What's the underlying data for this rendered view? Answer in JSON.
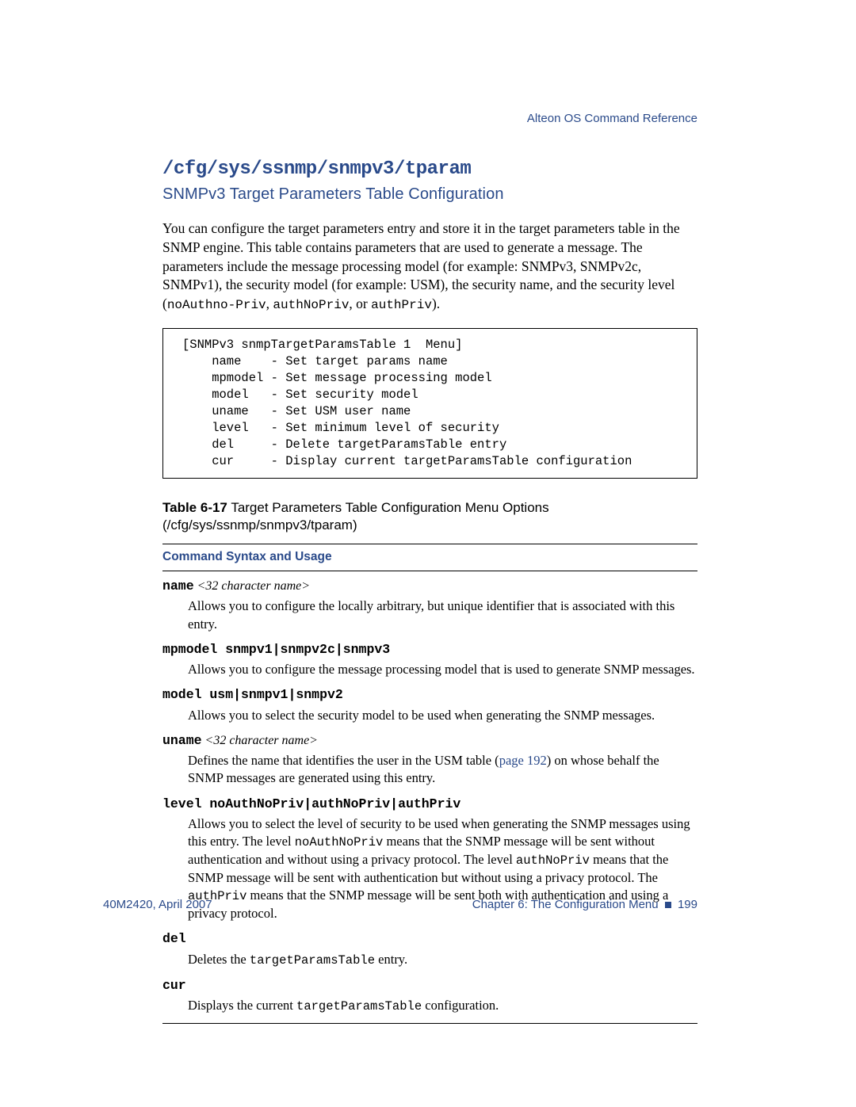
{
  "running_head": "Alteon OS  Command Reference",
  "h1": "/cfg/sys/ssnmp/snmpv3/tparam",
  "h2": "SNMPv3 Target Parameters Table Configuration",
  "intro_text_1": "You can configure the target parameters entry and store it in the target parameters table in the SNMP engine. This table contains parameters that are used to generate a message. The parameters include the message processing model (for example: SNMPv3, SNMPv2c, SNMPv1), the security model (for example: USM), the security name, and the security level (",
  "intro_code_1": "noAuthno-Priv",
  "intro_sep_1": ", ",
  "intro_code_2": "authNoPriv",
  "intro_sep_2": ", or ",
  "intro_code_3": "authPriv",
  "intro_tail": ").",
  "menu_header": "[SNMPv3 snmpTargetParamsTable 1  Menu]",
  "menu_items": [
    {
      "cmd": "name",
      "desc": "Set target params name"
    },
    {
      "cmd": "mpmodel",
      "desc": "Set message processing model"
    },
    {
      "cmd": "model",
      "desc": "Set security model"
    },
    {
      "cmd": "uname",
      "desc": "Set USM user name"
    },
    {
      "cmd": "level",
      "desc": "Set minimum level of security"
    },
    {
      "cmd": "del",
      "desc": "Delete targetParamsTable entry"
    },
    {
      "cmd": "cur",
      "desc": "Display current targetParamsTable configuration"
    }
  ],
  "table_caption_label": "Table 6-17",
  "table_caption_text": "Target Parameters Table Configuration Menu Options (/cfg/sys/ssnmp/snmpv3/tparam)",
  "colhead": "Command Syntax and Usage",
  "entries": {
    "name": {
      "syntax_cmd": "name",
      "syntax_arg": "<32 character name>",
      "desc": "Allows you to configure the locally arbitrary, but unique identifier that is associated with this entry."
    },
    "mpmodel": {
      "syntax_cmd": "mpmodel snmpv1",
      "syntax_alt1": "snmpv2c",
      "syntax_alt2": "snmpv3",
      "desc": "Allows you to configure the message processing model that is used to generate SNMP messages."
    },
    "model": {
      "syntax_cmd": "model usm",
      "syntax_alt1": "snmpv1",
      "syntax_alt2": "snmpv2",
      "desc": "Allows you to select the security model to be used when generating the SNMP messages."
    },
    "uname": {
      "syntax_cmd": "uname",
      "syntax_arg": "<32 character name>",
      "desc_pre": "Defines the name that identifies the user in the USM table (",
      "link": "page 192",
      "desc_post": ") on whose behalf the SNMP messages are generated using this entry."
    },
    "level": {
      "syntax_cmd": "level noAuthNoPriv",
      "syntax_alt1": "authNoPriv",
      "syntax_alt2": "authPriv",
      "desc_p1": "Allows you to select the level of security to be used when generating the SNMP messages using this entry. The level ",
      "code1": "noAuthNoPriv",
      "desc_p2": " means that the SNMP message will be sent without authentication and without using a privacy protocol. The level ",
      "code2": "authNoPriv",
      "desc_p3": " means that the SNMP message will be sent with authentication but without using a privacy protocol. The ",
      "code3": "authPriv",
      "desc_p4": " means that the SNMP message will be sent both with authentication and using a privacy protocol."
    },
    "del": {
      "syntax_cmd": "del",
      "desc_pre": "Deletes the ",
      "code": "targetParamsTable",
      "desc_post": " entry."
    },
    "cur": {
      "syntax_cmd": "cur",
      "desc_pre": "Displays the current ",
      "code": "targetParamsTable",
      "desc_post": " configuration."
    }
  },
  "footer_left": "40M2420, April 2007",
  "footer_right_chapter": "Chapter 6:  The Configuration Menu",
  "footer_page": "199",
  "pipe": "|"
}
